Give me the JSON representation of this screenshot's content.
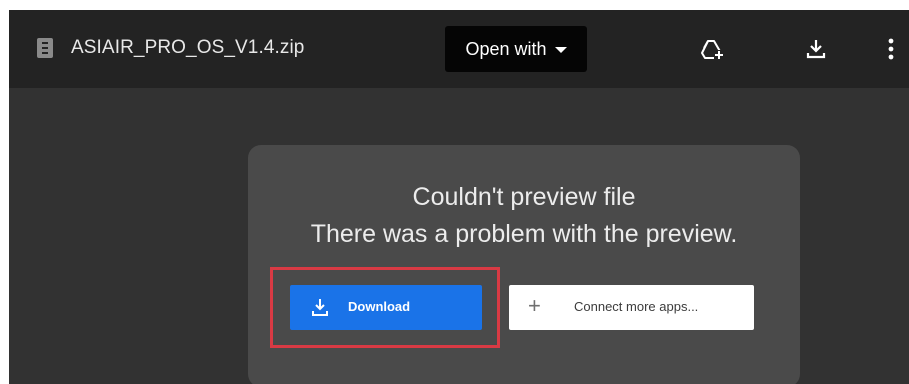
{
  "header": {
    "file_name": "ASIAIR_PRO_OS_V1.4.zip",
    "file_icon": "file-icon",
    "open_with_label": "Open with",
    "icons": [
      "add-to-drive-icon",
      "download-icon",
      "more-vert-icon"
    ]
  },
  "preview_error": {
    "title": "Couldn't preview file",
    "message": "There was a problem with the preview.",
    "download_label": "Download",
    "connect_apps_label": "Connect more apps..."
  },
  "colors": {
    "topbar": "#232323",
    "background": "#323232",
    "dialog": "#4a4a4a",
    "primary_button": "#1a73e8",
    "highlight_border": "#d93a44"
  }
}
